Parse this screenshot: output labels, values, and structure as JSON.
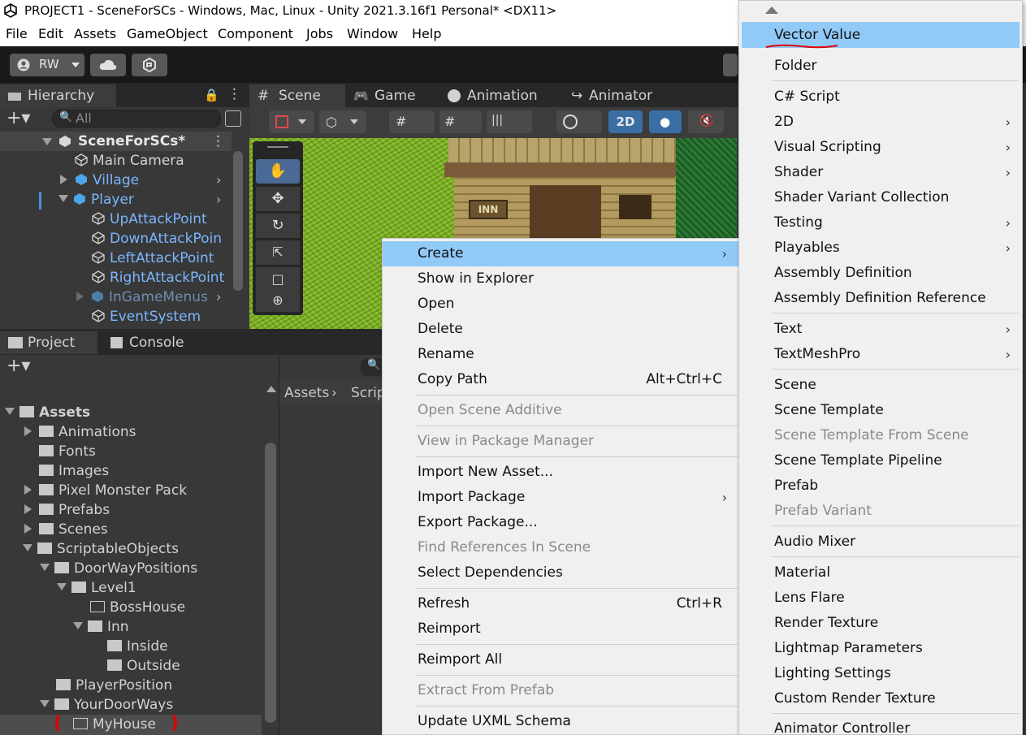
{
  "window": {
    "title": "PROJECT1 - SceneForSCs - Windows, Mac, Linux - Unity 2021.3.16f1 Personal* <DX11>"
  },
  "menubar": [
    "File",
    "Edit",
    "Assets",
    "GameObject",
    "Component",
    "Jobs",
    "Window",
    "Help"
  ],
  "toolbar": {
    "account": "RW"
  },
  "hierarchy": {
    "tab": "Hierarchy",
    "search_placeholder": "All",
    "scene_name": "SceneForSCs*",
    "items": [
      {
        "label": "Main Camera"
      },
      {
        "label": "Village"
      },
      {
        "label": "Player"
      },
      {
        "label": "UpAttackPoint"
      },
      {
        "label": "DownAttackPoin"
      },
      {
        "label": "LeftAttackPoint"
      },
      {
        "label": "RightAttackPoint"
      },
      {
        "label": "InGameMenus"
      },
      {
        "label": "EventSystem"
      }
    ]
  },
  "scene_tabs": [
    "Scene",
    "Game",
    "Animation",
    "Animator"
  ],
  "scene_toolbar": {
    "mode_2d": "2D"
  },
  "project": {
    "tabs": [
      "Project",
      "Console"
    ],
    "breadcrumb": [
      "Assets",
      "Scrip"
    ],
    "tree": [
      {
        "label": "Assets"
      },
      {
        "label": "Animations"
      },
      {
        "label": "Fonts"
      },
      {
        "label": "Images"
      },
      {
        "label": "Pixel Monster Pack"
      },
      {
        "label": "Prefabs"
      },
      {
        "label": "Scenes"
      },
      {
        "label": "ScriptableObjects"
      },
      {
        "label": "DoorWayPositions"
      },
      {
        "label": "Level1"
      },
      {
        "label": "BossHouse"
      },
      {
        "label": "Inn"
      },
      {
        "label": "Inside"
      },
      {
        "label": "Outside"
      },
      {
        "label": "PlayerPosition"
      },
      {
        "label": "YourDoorWays"
      },
      {
        "label": "MyHouse"
      }
    ]
  },
  "context_menu": {
    "items": [
      {
        "label": "Create",
        "shortcut": "",
        "submenu": true
      },
      {
        "label": "Show in Explorer",
        "shortcut": ""
      },
      {
        "label": "Open",
        "shortcut": ""
      },
      {
        "label": "Delete",
        "shortcut": ""
      },
      {
        "label": "Rename",
        "shortcut": ""
      },
      {
        "label": "Copy Path",
        "shortcut": "Alt+Ctrl+C"
      },
      {
        "label": "Open Scene Additive",
        "shortcut": "",
        "disabled": true
      },
      {
        "label": "View in Package Manager",
        "shortcut": "",
        "disabled": true
      },
      {
        "label": "Import New Asset...",
        "shortcut": ""
      },
      {
        "label": "Import Package",
        "shortcut": "",
        "submenu": true
      },
      {
        "label": "Export Package...",
        "shortcut": ""
      },
      {
        "label": "Find References In Scene",
        "shortcut": "",
        "disabled": true
      },
      {
        "label": "Select Dependencies",
        "shortcut": ""
      },
      {
        "label": "Refresh",
        "shortcut": "Ctrl+R"
      },
      {
        "label": "Reimport",
        "shortcut": ""
      },
      {
        "label": "Reimport All",
        "shortcut": ""
      },
      {
        "label": "Extract From Prefab",
        "shortcut": "",
        "disabled": true
      },
      {
        "label": "Update UXML Schema",
        "shortcut": ""
      }
    ]
  },
  "create_menu": {
    "items": [
      {
        "label": "Vector Value"
      },
      {
        "label": "Folder"
      },
      {
        "label": "C# Script"
      },
      {
        "label": "2D",
        "submenu": true
      },
      {
        "label": "Visual Scripting",
        "submenu": true
      },
      {
        "label": "Shader",
        "submenu": true
      },
      {
        "label": "Shader Variant Collection"
      },
      {
        "label": "Testing",
        "submenu": true
      },
      {
        "label": "Playables",
        "submenu": true
      },
      {
        "label": "Assembly Definition"
      },
      {
        "label": "Assembly Definition Reference"
      },
      {
        "label": "Text",
        "submenu": true
      },
      {
        "label": "TextMeshPro",
        "submenu": true
      },
      {
        "label": "Scene"
      },
      {
        "label": "Scene Template"
      },
      {
        "label": "Scene Template From Scene",
        "disabled": true
      },
      {
        "label": "Scene Template Pipeline"
      },
      {
        "label": "Prefab"
      },
      {
        "label": "Prefab Variant",
        "disabled": true
      },
      {
        "label": "Audio Mixer"
      },
      {
        "label": "Material"
      },
      {
        "label": "Lens Flare"
      },
      {
        "label": "Render Texture"
      },
      {
        "label": "Lightmap Parameters"
      },
      {
        "label": "Lighting Settings"
      },
      {
        "label": "Custom Render Texture"
      },
      {
        "label": "Animator Controller"
      }
    ]
  },
  "colors": {
    "highlight": "#91c9f7",
    "annotation_red": "#e00000",
    "hierarchy_blue": "#7cb6ff"
  }
}
